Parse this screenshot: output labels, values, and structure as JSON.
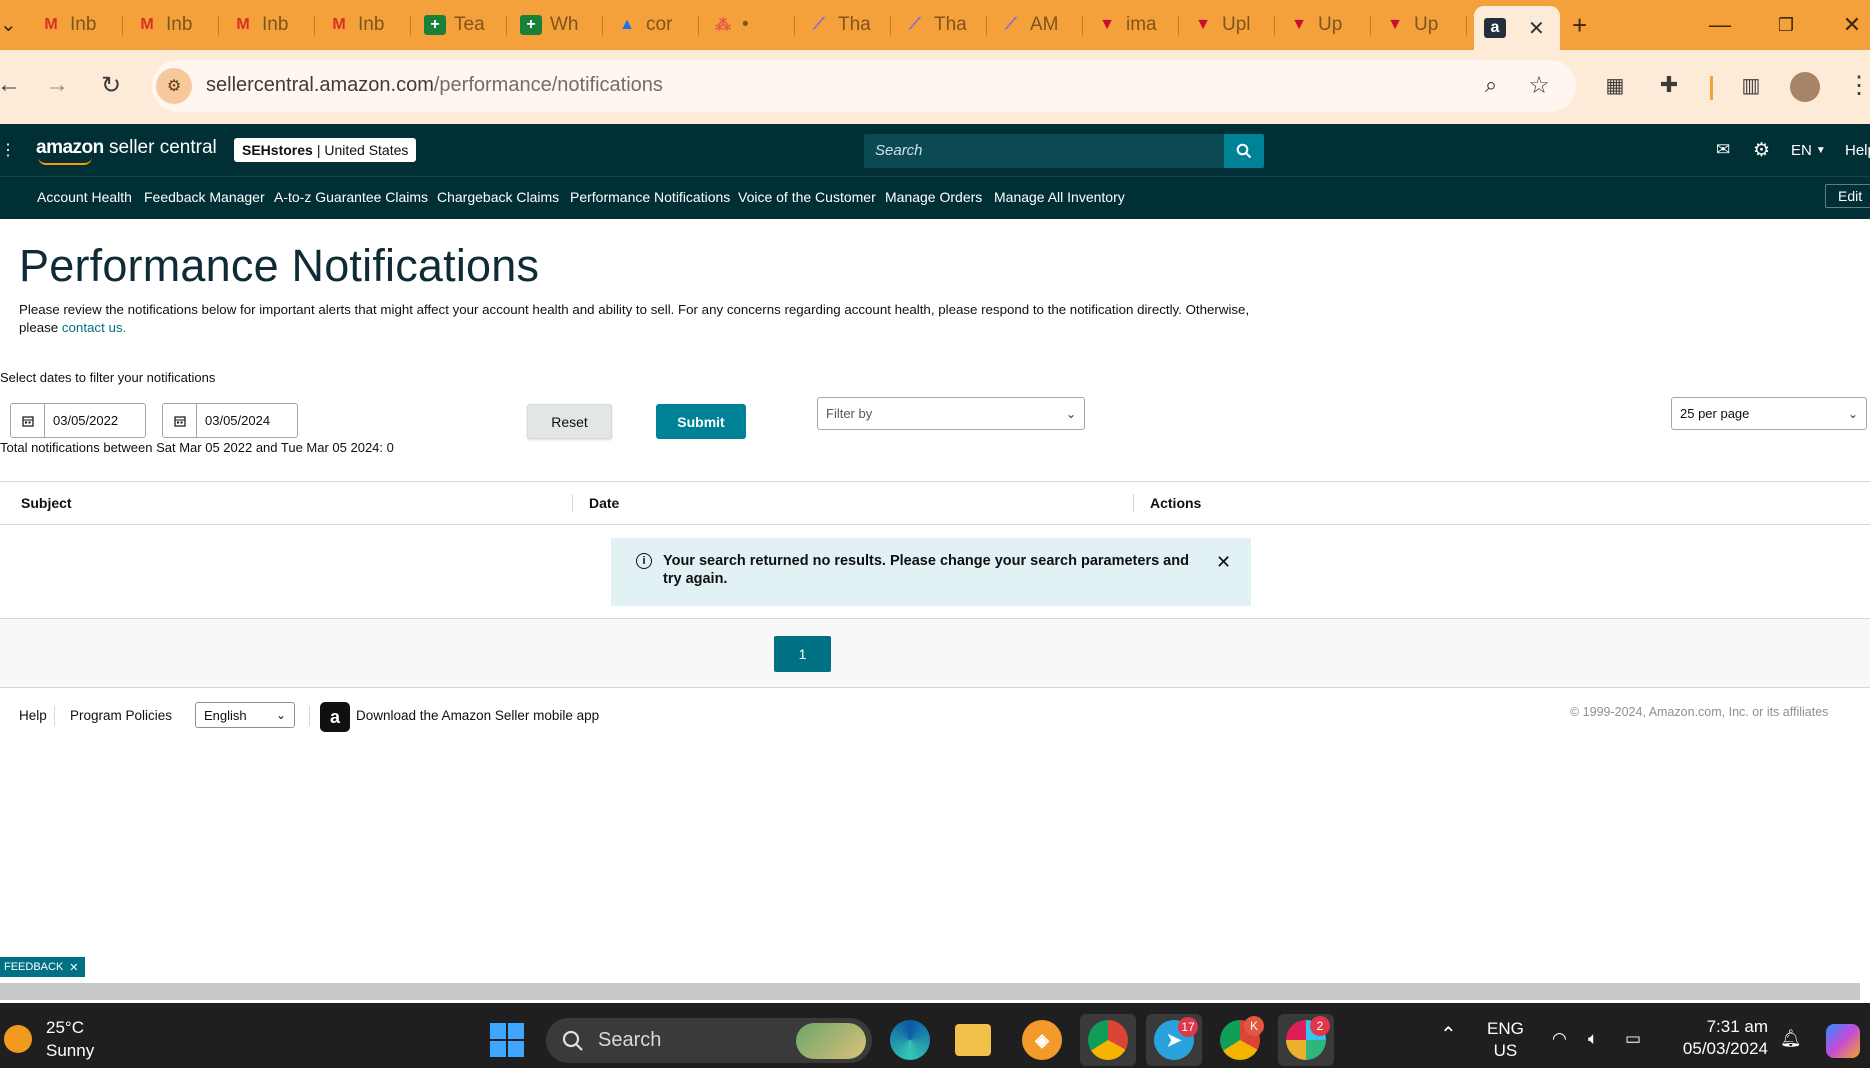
{
  "browser": {
    "tabs": [
      {
        "title": "Inb",
        "icon": "gmail-icon",
        "glyph": "M"
      },
      {
        "title": "Inb",
        "icon": "gmail-icon",
        "glyph": "M"
      },
      {
        "title": "Inb",
        "icon": "gmail-icon",
        "glyph": "M"
      },
      {
        "title": "Inb",
        "icon": "gmail-icon",
        "glyph": "M"
      },
      {
        "title": "Tea",
        "icon": "sheets-icon",
        "glyph": "+"
      },
      {
        "title": "Wh",
        "icon": "sheets-icon",
        "glyph": "+"
      },
      {
        "title": "cor",
        "icon": "drive-icon",
        "glyph": "▲"
      },
      {
        "title": "•",
        "icon": "asana-icon",
        "glyph": "⁂"
      },
      {
        "title": "Tha",
        "icon": "clickup-icon",
        "glyph": "⟋"
      },
      {
        "title": "Tha",
        "icon": "clickup-icon",
        "glyph": "⟋"
      },
      {
        "title": "AM",
        "icon": "clickup-icon",
        "glyph": "⟋"
      },
      {
        "title": "ima",
        "icon": "up-icon",
        "glyph": "▼"
      },
      {
        "title": "Upl",
        "icon": "up-icon",
        "glyph": "▼"
      },
      {
        "title": "Up",
        "icon": "up-icon",
        "glyph": "▼"
      },
      {
        "title": "Up",
        "icon": "up-icon",
        "glyph": "▼"
      }
    ],
    "active_tab_glyph": "a",
    "url_host": "sellercentral.amazon.com",
    "url_path": "/performance/notifications",
    "colors": {
      "tab_strip": "#f4a13c",
      "toolbar": "#fdebd8"
    }
  },
  "seller_central": {
    "logo_bold": "amazon",
    "logo_text": "seller central",
    "store_name": "SEHstores",
    "store_region": "| United States",
    "search_placeholder": "Search",
    "language": "EN",
    "help": "Help",
    "nav": [
      "Account Health",
      "Feedback Manager",
      "A-to-z Guarantee Claims",
      "Chargeback Claims",
      "Performance Notifications",
      "Voice of the Customer",
      "Manage Orders",
      "Manage All Inventory"
    ],
    "edit": "Edit",
    "colors": {
      "header": "#002f36",
      "accent": "#008296"
    }
  },
  "page": {
    "title": "Performance Notifications",
    "description": "Please review the notifications below for important alerts that might affect your account health and ability to sell. For any concerns regarding account health, please respond to the notification directly. Otherwise, please",
    "contact_link": "contact us.",
    "filter_label": "Select dates to filter your notifications",
    "date_from": "03/05/2022",
    "date_to": "03/05/2024",
    "reset": "Reset",
    "submit": "Submit",
    "filter_by": "Filter by",
    "per_page": "25 per page",
    "total": "Total notifications between Sat Mar 05 2022 and Tue Mar 05 2024: 0",
    "columns": [
      "Subject",
      "Date",
      "Actions"
    ],
    "alert": "Your search returned no results. Please change your search parameters and try again.",
    "current_page": "1"
  },
  "footer": {
    "help": "Help",
    "policies": "Program Policies",
    "language": "English",
    "app_text": "Download the Amazon Seller mobile app",
    "copyright": "© 1999-2024, Amazon.com, Inc. or its affiliates",
    "feedback": "FEEDBACK"
  },
  "taskbar": {
    "temp": "25°C",
    "weather": "Sunny",
    "search": "Search",
    "telegram_badge": "17",
    "chrome_badge": "K",
    "slack_badge": "2",
    "lang_top": "ENG",
    "lang_bottom": "US",
    "time": "7:31 am",
    "date": "05/03/2024"
  }
}
